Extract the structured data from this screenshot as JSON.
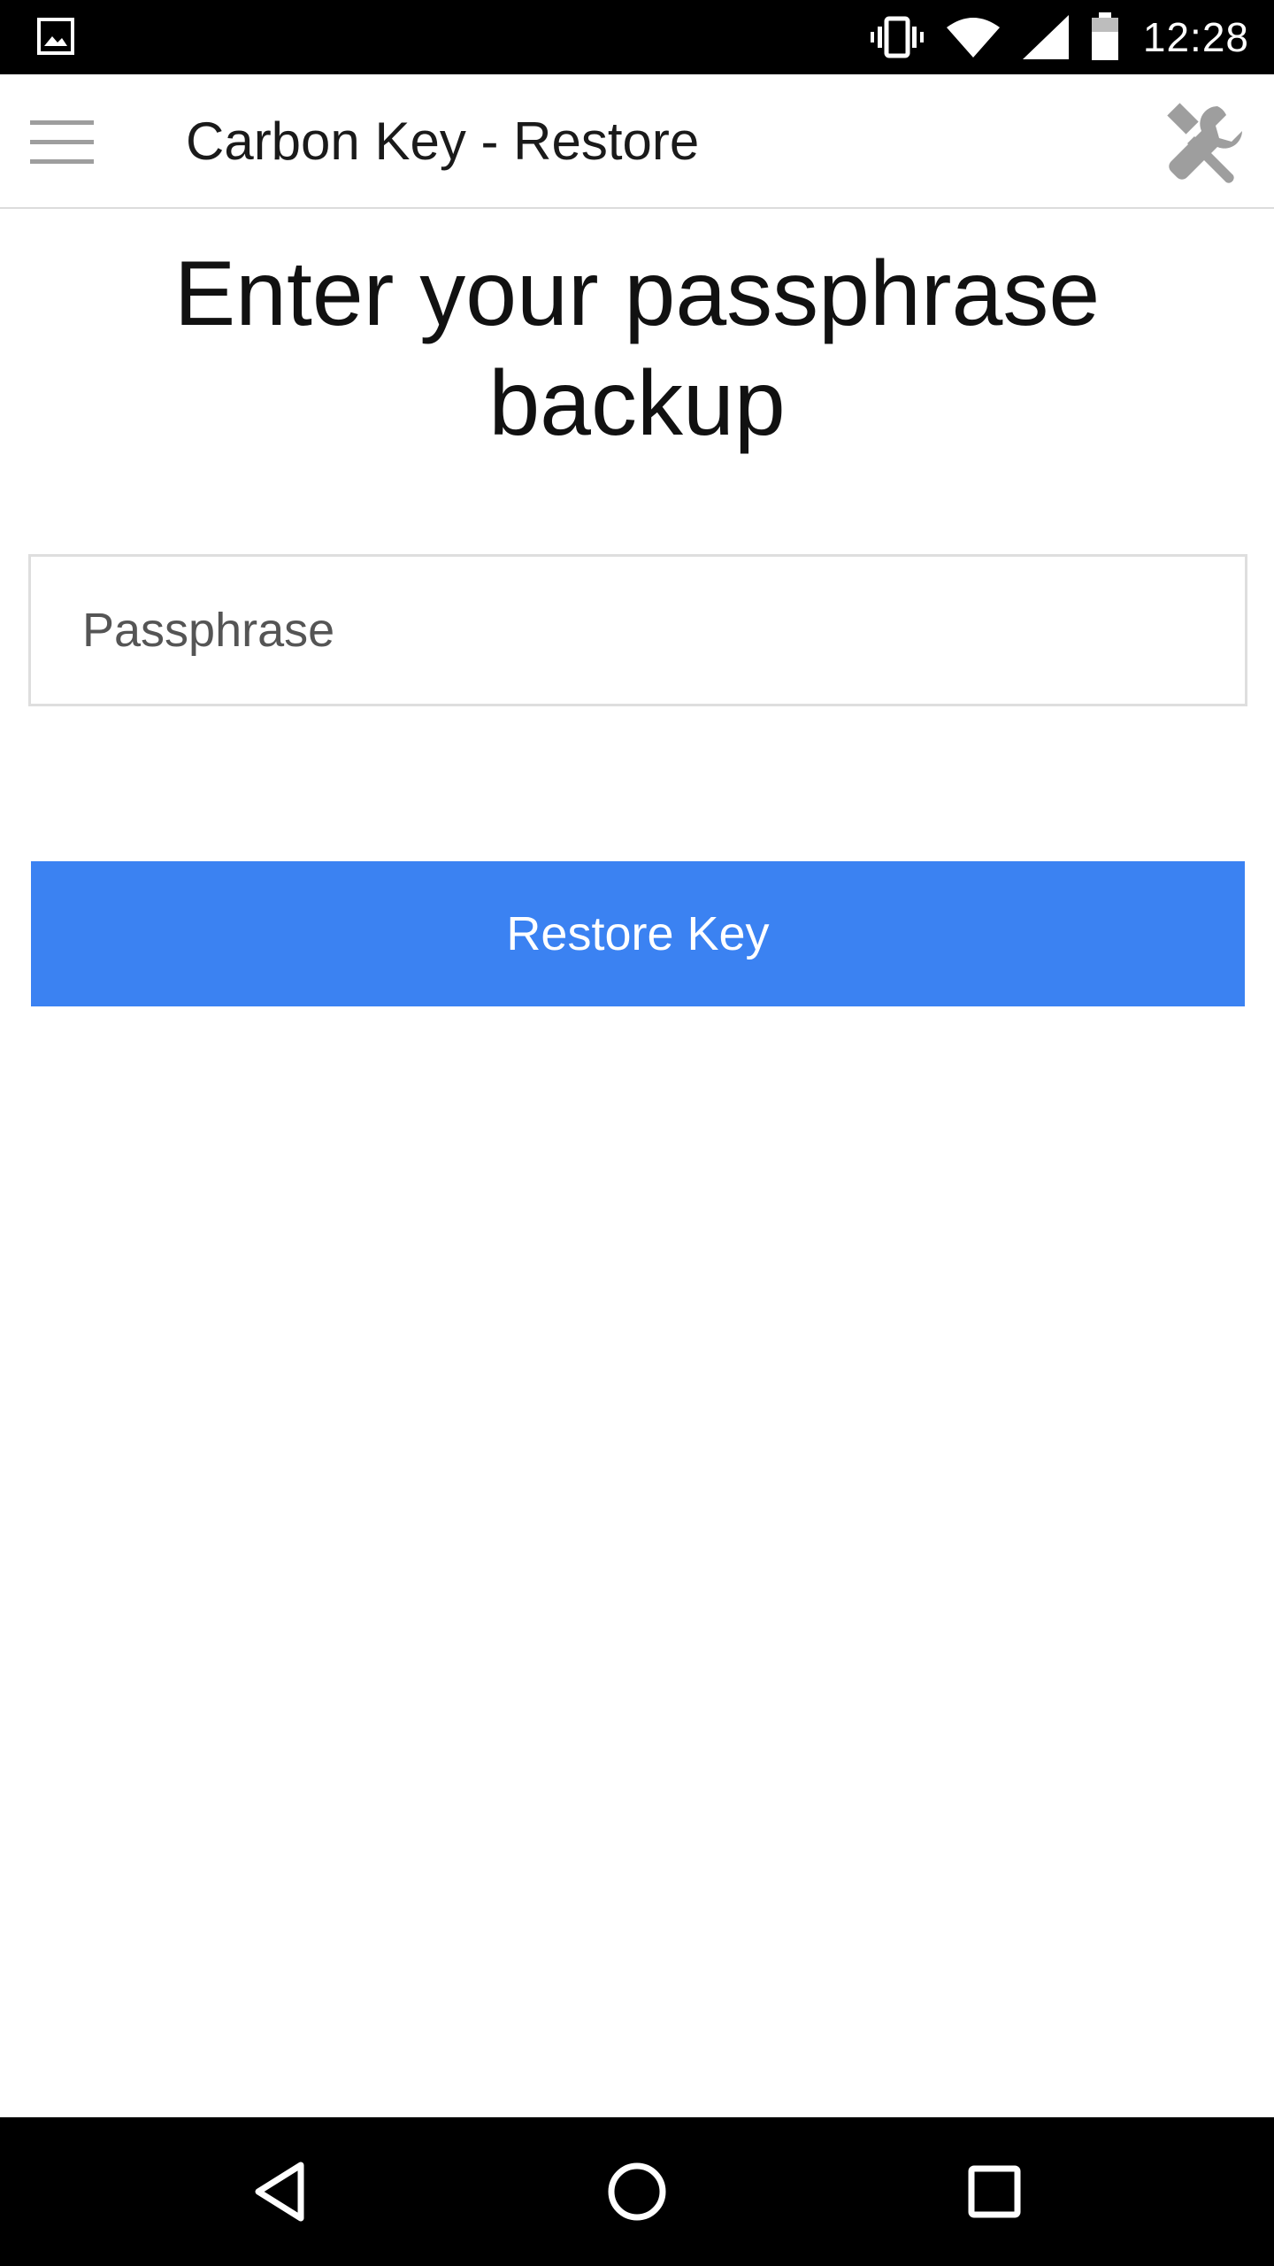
{
  "status_bar": {
    "time": "12:28",
    "icons": [
      "gallery-notification-icon",
      "vibrate-icon",
      "wifi-icon",
      "cell-signal-icon",
      "battery-icon"
    ]
  },
  "app_bar": {
    "title": "Carbon Key - Restore",
    "left_icon": "menu-icon",
    "right_icon": "tools-icon"
  },
  "main": {
    "heading_line1": "Enter your passphrase",
    "heading_line2": "backup",
    "passphrase_input": {
      "value": "",
      "placeholder": "Passphrase"
    },
    "restore_button_label": "Restore Key"
  },
  "nav_bar": {
    "buttons": [
      "back-icon",
      "home-icon",
      "recents-icon"
    ]
  },
  "colors": {
    "accent": "#3b82f2",
    "status_bar_bg": "#000000",
    "icon_gray": "#9e9e9e"
  }
}
